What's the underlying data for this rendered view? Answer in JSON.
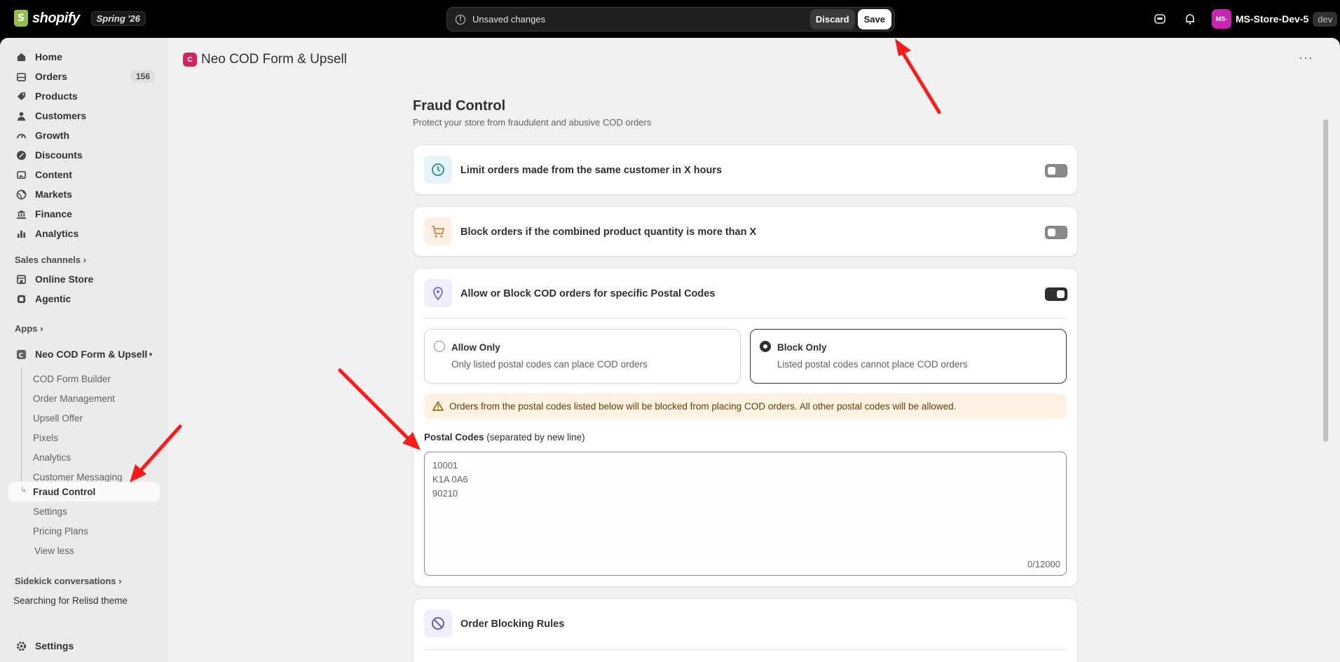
{
  "topbar": {
    "brand": "shopify",
    "edition": "Spring '26",
    "unsaved_message": "Unsaved changes",
    "discard_label": "Discard",
    "save_label": "Save",
    "store_initials": "MS-",
    "store_name": "MS-Store-Dev-5",
    "store_badge": "dev"
  },
  "sidebar": {
    "items": [
      {
        "label": "Home",
        "icon": "home-icon"
      },
      {
        "label": "Orders",
        "icon": "orders-icon",
        "count": "156"
      },
      {
        "label": "Products",
        "icon": "tag-icon"
      },
      {
        "label": "Customers",
        "icon": "person-icon"
      },
      {
        "label": "Growth",
        "icon": "gauge-icon"
      },
      {
        "label": "Discounts",
        "icon": "discount-icon"
      },
      {
        "label": "Content",
        "icon": "image-icon"
      },
      {
        "label": "Markets",
        "icon": "globe-icon"
      },
      {
        "label": "Finance",
        "icon": "bank-icon"
      },
      {
        "label": "Analytics",
        "icon": "bar-chart-icon"
      }
    ],
    "sales_channels_label": "Sales channels",
    "channels": [
      {
        "label": "Online Store",
        "icon": "store-icon"
      },
      {
        "label": "Agentic",
        "icon": "agentic-icon"
      }
    ],
    "apps_label": "Apps",
    "app_name": "Neo COD Form & Upsell",
    "app_subitems": [
      "COD Form Builder",
      "Order Management",
      "Upsell Offer",
      "Pixels",
      "Analytics",
      "Customer Messaging"
    ],
    "active_subitem": "Fraud Control",
    "more_subitems": [
      "Settings",
      "Pricing Plans"
    ],
    "view_less": "View less",
    "sidekick_label": "Sidekick conversations",
    "sidekick_item": "Searching for Relisd theme",
    "settings_label": "Settings"
  },
  "app_header": {
    "title": "Neo COD Form & Upsell",
    "icon_text": "C"
  },
  "page": {
    "title": "Fraud Control",
    "subtitle": "Protect your store from fraudulent and abusive COD orders"
  },
  "features": [
    {
      "title": "Limit orders made from the same customer in X hours",
      "icon": "clock-icon",
      "enabled": false
    },
    {
      "title": "Block orders if the combined product quantity is more than X",
      "icon": "cart-icon",
      "enabled": false
    },
    {
      "title": "Allow or Block COD orders for specific Postal Codes",
      "icon": "location-pin-icon",
      "enabled": true
    }
  ],
  "postal": {
    "allow_title": "Allow Only",
    "allow_desc": "Only listed postal codes can place COD orders",
    "block_title": "Block Only",
    "block_desc": "Listed postal codes cannot place COD orders",
    "selected": "Block Only",
    "warning": "Orders from the postal codes listed below will be blocked from placing COD orders. All other postal codes will be allowed.",
    "field_label": "Postal Codes",
    "field_hint": "(separated by new line)",
    "placeholder": "10001\nK1A 0A6\n90210",
    "counter": "0/12000"
  },
  "blocking_rules": {
    "title": "Order Blocking Rules",
    "icon": "block-circle-icon"
  },
  "colors": {
    "accent_dark": "#303030",
    "annotation_arrow": "#ff1a1a",
    "warning_bg": "#fff1e3"
  }
}
